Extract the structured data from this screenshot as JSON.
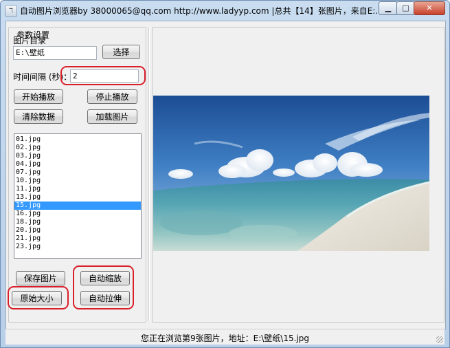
{
  "window": {
    "title": "自动图片浏览器by 38000065@qq.com http://www.ladyyp.com |总共【14】张图片，来自E:...",
    "minimize_glyph": "▁",
    "maximize_glyph": "□",
    "close_glyph": "✕"
  },
  "settings": {
    "group_label": "参数设置",
    "dir_label": "图片目录",
    "dir_value": "E:\\壁纸",
    "choose_button": "选择",
    "interval_label": "时间间隔 (秒)：",
    "interval_value": "2",
    "start_button": "开始播放",
    "stop_button": "停止播放",
    "clear_button": "清除数据",
    "load_button": "加载图片"
  },
  "files": [
    {
      "name": "01.jpg"
    },
    {
      "name": "02.jpg"
    },
    {
      "name": "03.jpg"
    },
    {
      "name": "04.jpg"
    },
    {
      "name": "07.jpg"
    },
    {
      "name": "10.jpg"
    },
    {
      "name": "11.jpg"
    },
    {
      "name": "13.jpg"
    },
    {
      "name": "15.jpg",
      "selected": true
    },
    {
      "name": "16.jpg"
    },
    {
      "name": "18.jpg"
    },
    {
      "name": "20.jpg"
    },
    {
      "name": "21.jpg"
    },
    {
      "name": "23.jpg"
    }
  ],
  "actions": {
    "save_button": "保存图片",
    "auto_zoom_button": "自动缩放",
    "original_size_button": "原始大小",
    "auto_stretch_button": "自动拉伸"
  },
  "status": {
    "text": "您正在浏览第9张图片，地址：E:\\壁纸\\15.jpg"
  },
  "colors": {
    "highlight": "#d91f2a",
    "selection": "#3399ff",
    "titlebar": "#c9dcf0"
  }
}
